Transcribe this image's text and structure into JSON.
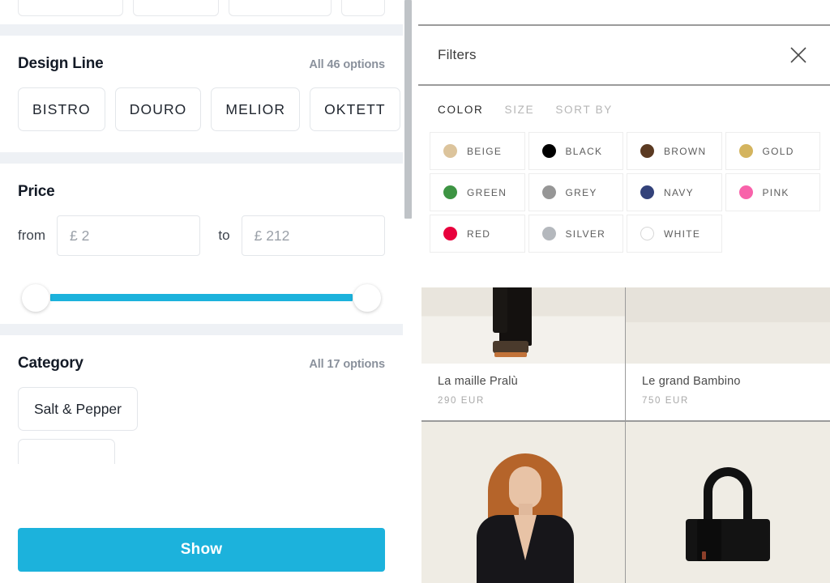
{
  "left_panel": {
    "sections": [
      {
        "id": "design-line",
        "title": "Design Line",
        "all_options": "All 46 options",
        "chips": [
          "BISTRO",
          "DOURO",
          "MELIOR",
          "OKTETT"
        ]
      },
      {
        "id": "price",
        "title": "Price",
        "from_label": "from",
        "from_value": "£ 2",
        "to_label": "to",
        "to_value": "£ 212",
        "slider": {
          "track_color": "#1cb2dc",
          "min_handle_pct": 0,
          "max_handle_pct": 100
        }
      },
      {
        "id": "category",
        "title": "Category",
        "all_options": "All 17 options",
        "chips": [
          "Salt & Pepper"
        ]
      }
    ],
    "show_button": "Show",
    "accent_color": "#1cb2dc"
  },
  "right_panel": {
    "header": {
      "title": "Filters",
      "close_icon": "close-icon"
    },
    "tabs": [
      {
        "label": "COLOR",
        "active": true
      },
      {
        "label": "SIZE",
        "active": false
      },
      {
        "label": "SORT BY",
        "active": false
      }
    ],
    "colors": [
      {
        "name": "BEIGE",
        "hex": "#dcc49c",
        "ring": false
      },
      {
        "name": "BLACK",
        "hex": "#000000",
        "ring": false
      },
      {
        "name": "BROWN",
        "hex": "#5b3a22",
        "ring": false
      },
      {
        "name": "GOLD",
        "hex": "#d4b45e",
        "ring": false
      },
      {
        "name": "GREEN",
        "hex": "#3d9443",
        "ring": false
      },
      {
        "name": "GREY",
        "hex": "#969696",
        "ring": false
      },
      {
        "name": "NAVY",
        "hex": "#33427a",
        "ring": false
      },
      {
        "name": "PINK",
        "hex": "#f862aa",
        "ring": false
      },
      {
        "name": "RED",
        "hex": "#e8003c",
        "ring": false
      },
      {
        "name": "SILVER",
        "hex": "#b4b8bd",
        "ring": false
      },
      {
        "name": "WHITE",
        "hex": "#ffffff",
        "ring": true
      }
    ],
    "products": [
      {
        "name": "La maille Pralù",
        "price": "290 EUR"
      },
      {
        "name": "Le grand Bambino",
        "price": "750 EUR"
      }
    ]
  }
}
